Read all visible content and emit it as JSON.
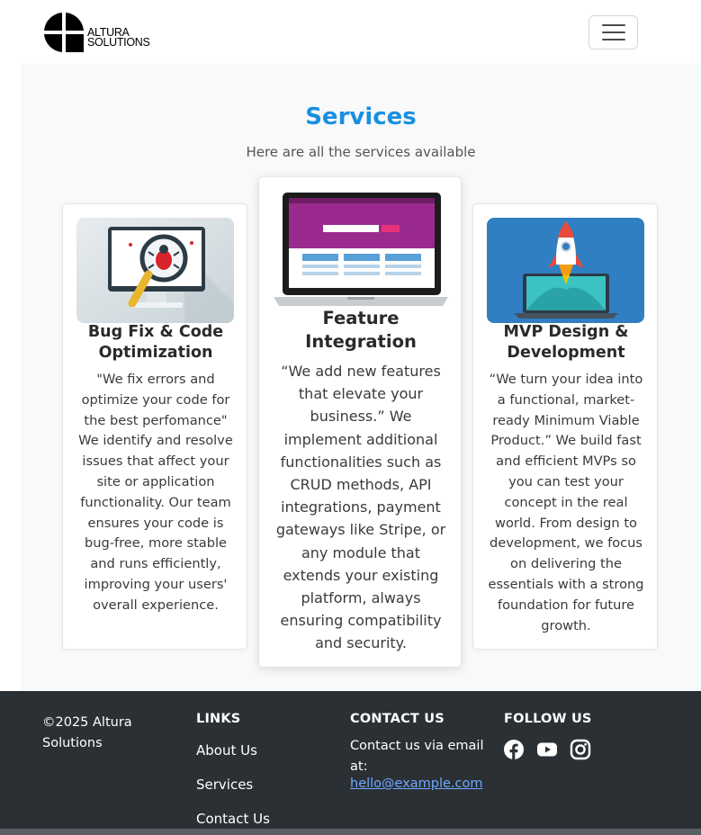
{
  "header": {
    "logo_text_line1": "ALTURA",
    "logo_text_line2": "SOLUTIONS",
    "menu_icon": "hamburger-icon"
  },
  "services": {
    "title": "Services",
    "subtitle": "Here are all the services available",
    "cards": [
      {
        "title": "Bug Fix & Code Optimization",
        "text": "\"We fix errors and optimize your code for the best perfomance\" We identify and resolve issues that affect your site or application functionality. Our team ensures your code is bug-free, more stable and runs efficiently, improving your users' overall experience.",
        "image": "bug-on-monitor-illustration"
      },
      {
        "title": "Feature Integration",
        "text": "“We add new features that elevate your business.” We implement additional functionalities such as CRUD methods, API integrations, payment gateways like Stripe, or any module that extends your existing platform, always ensuring compatibility and security.",
        "image": "laptop-website-illustration"
      },
      {
        "title": "MVP Design & Development",
        "text": "“We turn your idea into a functional, market-ready Minimum Viable Product.” We build fast and efficient MVPs so you can test your concept in the real world. From design to development, we focus on delivering the essentials with a strong foundation for future growth.",
        "image": "rocket-laptop-illustration"
      }
    ]
  },
  "footer": {
    "copyright": "©2025 Altura Solutions",
    "links_heading": "LINKS",
    "links": [
      "About Us",
      "Services",
      "Contact Us"
    ],
    "contact_heading": "CONTACT US",
    "contact_text": "Contact us via email at:",
    "contact_email": "hello@example.com",
    "follow_heading": "FOLLOW US",
    "social_icons": [
      "facebook-icon",
      "youtube-icon",
      "instagram-icon"
    ]
  },
  "colors": {
    "accent": "#1a8fe0",
    "footer_bg": "#2b3035",
    "link_blue": "#6ea8fe"
  }
}
